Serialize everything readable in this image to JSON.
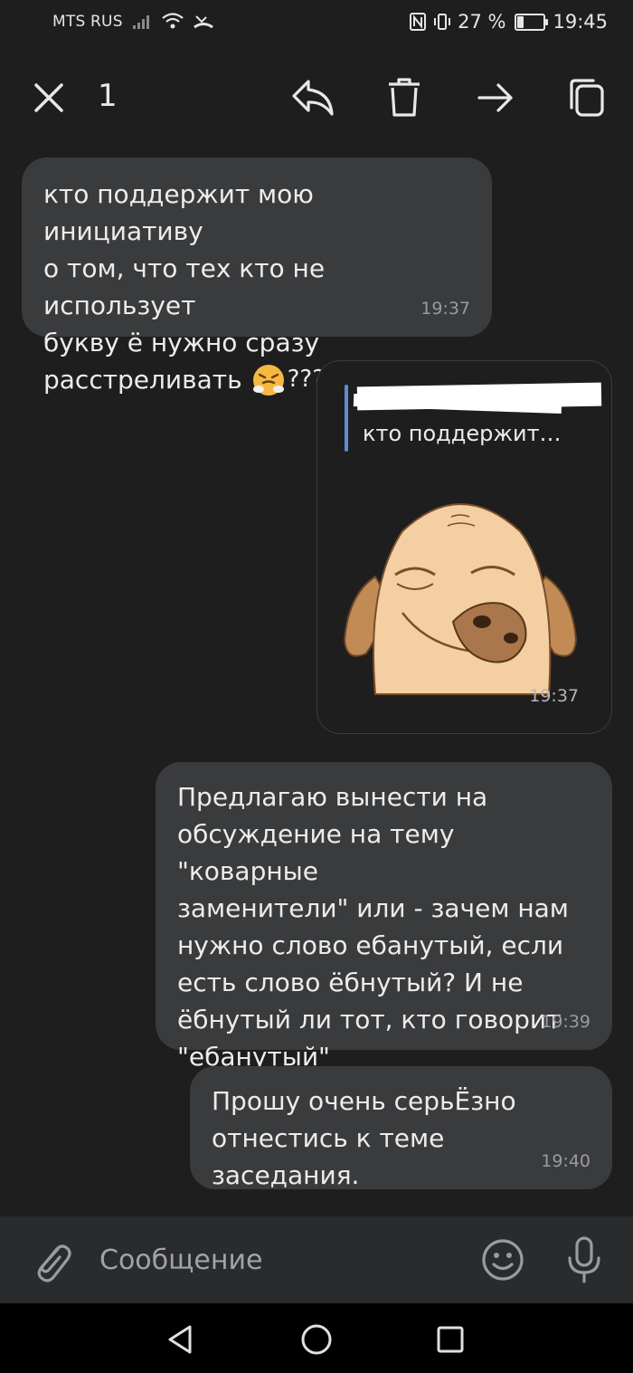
{
  "status_bar": {
    "carrier": "MTS RUS",
    "battery_percent": "27 %",
    "battery_level": 0.27,
    "time": "19:45"
  },
  "toolbar": {
    "selected_count": "1",
    "icons": [
      "close-icon",
      "reply-icon",
      "delete-icon",
      "forward-icon",
      "copy-icon"
    ]
  },
  "messages": [
    {
      "direction": "incoming",
      "lines": [
        "кто поддержит мою инициативу",
        "о том, что тех кто не использует",
        "букву ё нужно сразу",
        "расстреливать"
      ],
      "suffix": "?????!!!?",
      "time": "19:37"
    },
    {
      "direction": "outgoing",
      "type": "sticker",
      "reply_preview": "кто поддержит…",
      "time": "19:37"
    },
    {
      "direction": "outgoing",
      "lines": [
        "Предлагаю вынести на",
        "обсуждение на тему \"коварные",
        "заменители\" или - зачем нам",
        "нужно слово ебанутый, если",
        "есть слово ёбнутый? И не",
        "ёбнутый ли тот, кто говорит",
        "\"ебанутый\""
      ],
      "time": "19:39"
    },
    {
      "direction": "outgoing",
      "lines": [
        "Прошу очень серьЁзно",
        "отнестись к теме заседания."
      ],
      "time": "19:40"
    }
  ],
  "input": {
    "placeholder": "Сообщение"
  },
  "colors": {
    "background": "#1e1e1e",
    "bubble": "#3a3b3d",
    "reply_accent": "#5b8ed6",
    "input_bar": "#2a2b2d"
  }
}
